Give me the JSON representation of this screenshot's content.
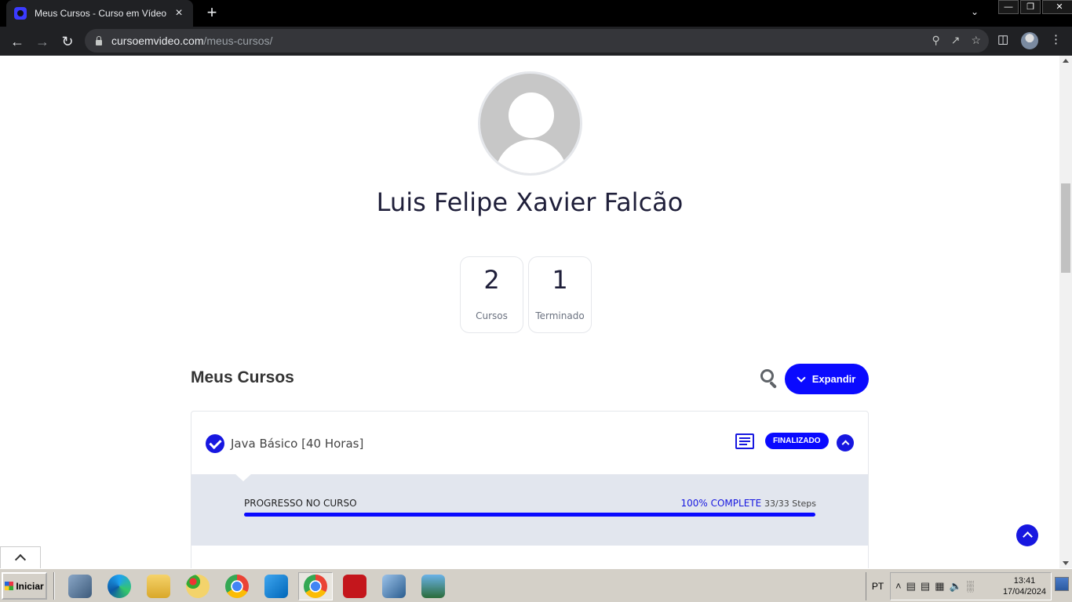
{
  "browser": {
    "tab_title": "Meus Cursos - Curso em Vídeo",
    "tab_close": "×",
    "new_tab": "+",
    "url_host": "cursoemvideo.com",
    "url_path": "/meus-cursos/"
  },
  "profile": {
    "name": "Luis Felipe Xavier Falcão",
    "stats": [
      {
        "value": "2",
        "label": "Cursos"
      },
      {
        "value": "1",
        "label": "Terminado"
      }
    ]
  },
  "courses_section": {
    "title": "Meus Cursos",
    "expand_label": "Expandir"
  },
  "courses": [
    {
      "title": "Java Básico [40 Horas]",
      "status_badge": "FINALIZADO",
      "progress_label": "PROGRESSO NO CURSO",
      "progress_text": "100% COMPLETE",
      "steps_text": "33/33 Steps",
      "progress_fraction": 1.0
    }
  ],
  "taskbar": {
    "start_label": "Iniciar",
    "lang": "PT",
    "time": "13:41",
    "date": "17/04/2024"
  },
  "colors": {
    "accent": "#0a0aff",
    "browser_dark": "#202124"
  },
  "icons": [
    "search-icon",
    "chevron-down-icon",
    "check-circle-icon",
    "certificate-icon",
    "chevron-up-icon",
    "back-to-top-icon"
  ]
}
